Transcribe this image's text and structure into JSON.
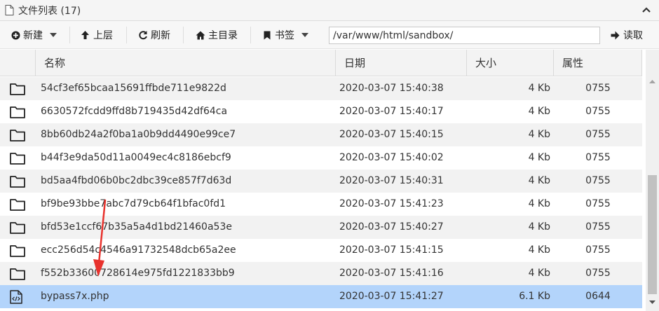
{
  "panel": {
    "title": "文件列表 (17)"
  },
  "toolbar": {
    "new_label": "新建",
    "up_label": "上层",
    "refresh_label": "刷新",
    "home_label": "主目录",
    "bookmark_label": "书签",
    "path_value": "/var/www/html/sandbox/",
    "read_label": "读取"
  },
  "table": {
    "columns": [
      "名称",
      "日期",
      "大小",
      "属性"
    ],
    "rows": [
      {
        "type": "folder",
        "name": "54cf3ef65bcaa15691ffbde711e9822d",
        "date": "2020-03-07 15:40:38",
        "size": "4 Kb",
        "perm": "0755"
      },
      {
        "type": "folder",
        "name": "6630572fcdd9ffd8b719435d42df64ca",
        "date": "2020-03-07 15:40:17",
        "size": "4 Kb",
        "perm": "0755"
      },
      {
        "type": "folder",
        "name": "8bb60db24a2f0ba1a0b9dd4490e99ce7",
        "date": "2020-03-07 15:40:15",
        "size": "4 Kb",
        "perm": "0755"
      },
      {
        "type": "folder",
        "name": "b44f3e9da50d11a0049ec4c8186ebcf9",
        "date": "2020-03-07 15:40:02",
        "size": "4 Kb",
        "perm": "0755"
      },
      {
        "type": "folder",
        "name": "bd5aa4fbd06b0bc2dbc39ce857f7d63d",
        "date": "2020-03-07 15:40:31",
        "size": "4 Kb",
        "perm": "0755"
      },
      {
        "type": "folder",
        "name": "bf9be93bbe7abc7d79cb64f1bfac0fd1",
        "date": "2020-03-07 15:41:23",
        "size": "4 Kb",
        "perm": "0755"
      },
      {
        "type": "folder",
        "name": "bfd53e1ccf67b35a5a4d1bd21460a53e",
        "date": "2020-03-07 15:40:27",
        "size": "4 Kb",
        "perm": "0755"
      },
      {
        "type": "folder",
        "name": "ecc256d54c4546a91732548dcb65a2ee",
        "date": "2020-03-07 15:41:15",
        "size": "4 Kb",
        "perm": "0755"
      },
      {
        "type": "folder",
        "name": "f552b33600728614e975fd1221833bb9",
        "date": "2020-03-07 15:41:16",
        "size": "4 Kb",
        "perm": "0755"
      },
      {
        "type": "php",
        "name": "bypass7x.php",
        "date": "2020-03-07 15:41:27",
        "size": "6.1 Kb",
        "perm": "0644"
      }
    ]
  },
  "colors": {
    "selected_row": "#b3d4fb",
    "annotation_arrow": "#e8322d"
  },
  "icons": [
    "file-icon",
    "chevron-up-icon",
    "plus-circle-icon",
    "caret-down-icon",
    "arrow-up-icon",
    "refresh-icon",
    "home-icon",
    "bookmark-icon",
    "arrow-right-icon",
    "folder-icon",
    "code-file-icon"
  ]
}
